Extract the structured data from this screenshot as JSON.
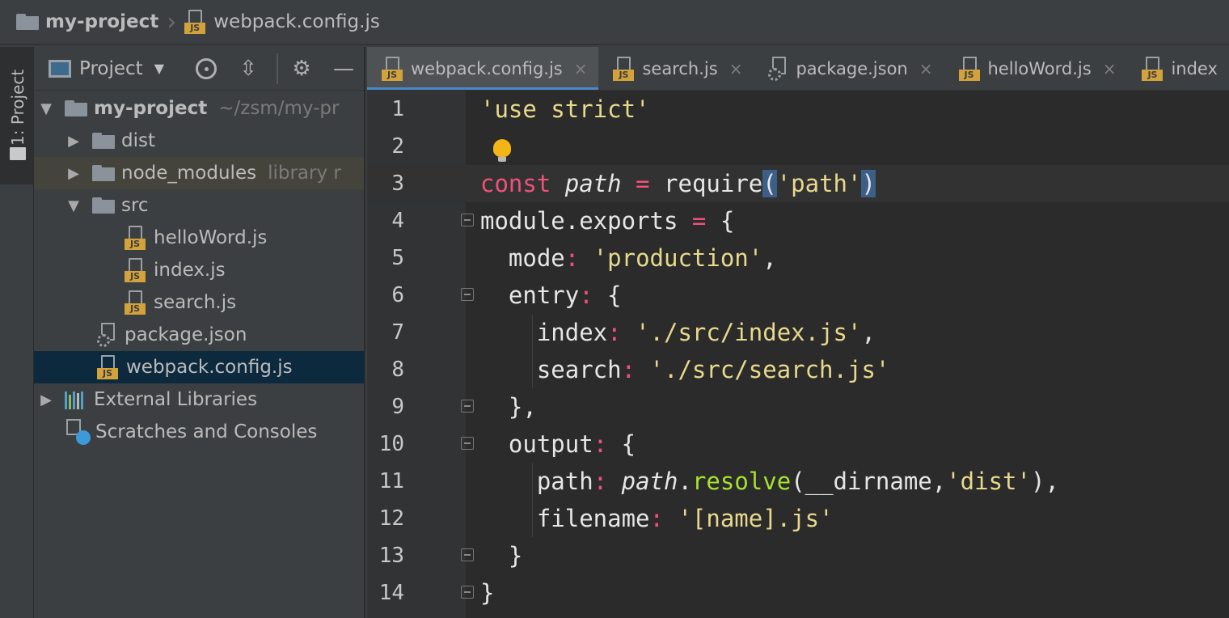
{
  "breadcrumb": {
    "project": "my-project",
    "file": "webpack.config.js",
    "separator": "›"
  },
  "tool_strip": {
    "project_tab_label": "1: Project"
  },
  "project_panel": {
    "title": "Project",
    "dropdown_icon": "chevron-down-icon",
    "header_icons": [
      "locate-target-icon",
      "collapse-all-icon",
      "gear-icon",
      "hide-minus-icon"
    ],
    "tree": [
      {
        "label": "my-project",
        "hint": "~/zsm/my-pr",
        "icon": "folder-icon",
        "expanded": true,
        "bold": true
      },
      {
        "label": "dist",
        "icon": "folder-icon",
        "expanded": false
      },
      {
        "label": "node_modules",
        "hint": "library r",
        "icon": "folder-icon",
        "expanded": false
      },
      {
        "label": "src",
        "icon": "folder-icon",
        "expanded": true
      },
      {
        "label": "helloWord.js",
        "icon": "js-file-icon"
      },
      {
        "label": "index.js",
        "icon": "js-file-icon"
      },
      {
        "label": "search.js",
        "icon": "js-file-icon"
      },
      {
        "label": "package.json",
        "icon": "json-file-icon"
      },
      {
        "label": "webpack.config.js",
        "icon": "js-file-icon",
        "selected": true
      },
      {
        "label": "External Libraries",
        "icon": "library-icon",
        "expanded": false
      },
      {
        "label": "Scratches and Consoles",
        "icon": "scratches-icon"
      }
    ]
  },
  "editor": {
    "tabs": [
      {
        "label": "webpack.config.js",
        "active": true,
        "icon": "js-file-icon",
        "close": "×"
      },
      {
        "label": "search.js",
        "icon": "js-file-icon",
        "close": "×"
      },
      {
        "label": "package.json",
        "icon": "json-file-icon",
        "close": "×"
      },
      {
        "label": "helloWord.js",
        "icon": "js-file-icon",
        "close": "×"
      },
      {
        "label": "index",
        "icon": "js-file-icon"
      }
    ],
    "language_badge": "JS",
    "line_numbers": [
      "1",
      "2",
      "3",
      "4",
      "5",
      "6",
      "7",
      "8",
      "9",
      "10",
      "11",
      "12",
      "13",
      "14"
    ],
    "code": {
      "l1_str": "'use strict'",
      "l3_const": "const",
      "l3_var": "path",
      "l3_eq": "=",
      "l3_require": "require",
      "l3_open": "(",
      "l3_arg": "'path'",
      "l3_close": ")",
      "l4_text": "module.exports",
      "l4_eq": "=",
      "l4_brace": "{",
      "l5_key": "mode",
      "l5_colon": ":",
      "l5_val": "'production'",
      "l5_comma": ",",
      "l6_key": "entry",
      "l6_colon": ":",
      "l6_brace": "{",
      "l7_key": "index",
      "l7_colon": ":",
      "l7_val": "'./src/index.js'",
      "l7_comma": ",",
      "l8_key": "search",
      "l8_colon": ":",
      "l8_val": "'./src/search.js'",
      "l9_text": "},",
      "l10_key": "output",
      "l10_colon": ":",
      "l10_brace": "{",
      "l11_key": "path",
      "l11_colon": ":",
      "l11_obj": "path",
      "l11_dot": ".",
      "l11_fn": "resolve",
      "l11_args_a": "(__dirname,",
      "l11_arg_str": "'dist'",
      "l11_args_b": "),",
      "l12_key": "filename",
      "l12_colon": ":",
      "l12_val": "'[name].js'",
      "l13_text": "}",
      "l14_text": "}"
    }
  },
  "colors": {
    "keyword": "#f0517a",
    "string": "#e8d98c",
    "function": "#a6e22e",
    "selection": "#0d293e",
    "tab_underline": "#4a88c7"
  }
}
